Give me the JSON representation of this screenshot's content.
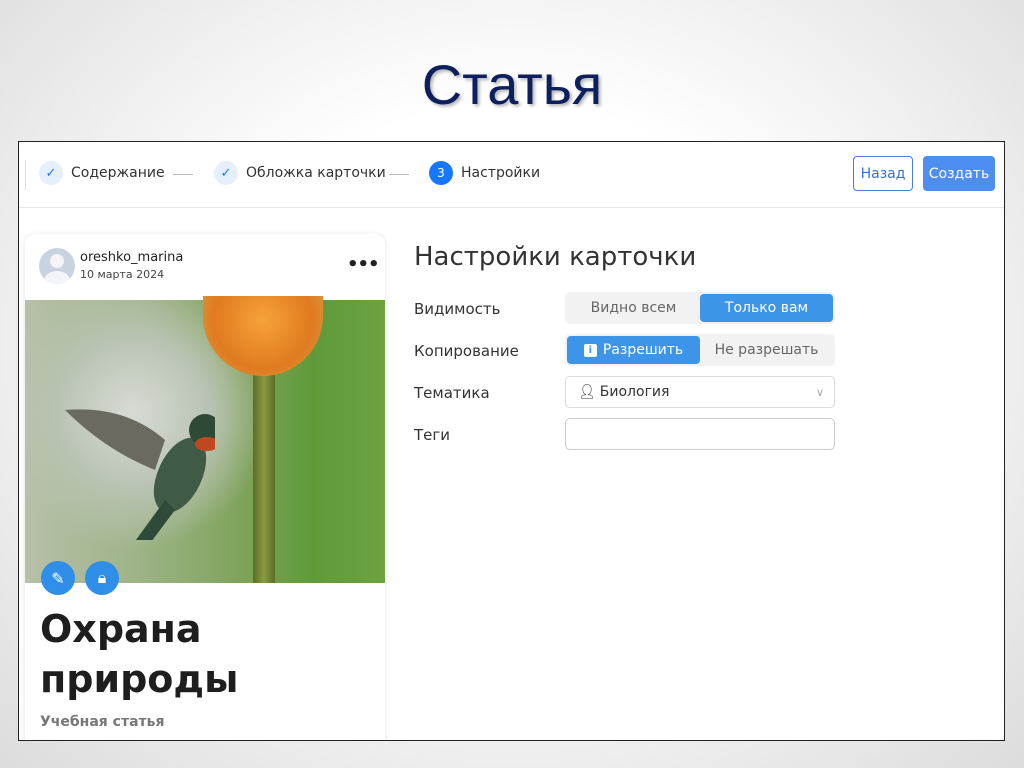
{
  "slide_title": "Статья",
  "steps": [
    {
      "label": "Содержание",
      "state": "done"
    },
    {
      "label": "Обложка карточки",
      "state": "done"
    },
    {
      "label": "Настройки",
      "number": "3",
      "state": "active"
    }
  ],
  "buttons": {
    "back": "Назад",
    "create": "Создать"
  },
  "card": {
    "username": "oreshko_marina",
    "date": "10 марта 2024",
    "more": "•••",
    "title_line1": "Охрана",
    "title_line2": "природы",
    "subtitle": "Учебная статья"
  },
  "settings": {
    "heading": "Настройки карточки",
    "visibility": {
      "label": "Видимость",
      "options": [
        "Видно всем",
        "Только вам"
      ],
      "selected": "Только вам"
    },
    "copying": {
      "label": "Копирование",
      "options": [
        "Разрешить",
        "Не разрешать"
      ],
      "selected": "Разрешить"
    },
    "topic": {
      "label": "Тематика",
      "value": "Биология"
    },
    "tags": {
      "label": "Теги",
      "value": ""
    }
  },
  "colors": {
    "accent": "#1677ff",
    "segment_active": "#3d95ea",
    "title": "#0d1f5c"
  }
}
